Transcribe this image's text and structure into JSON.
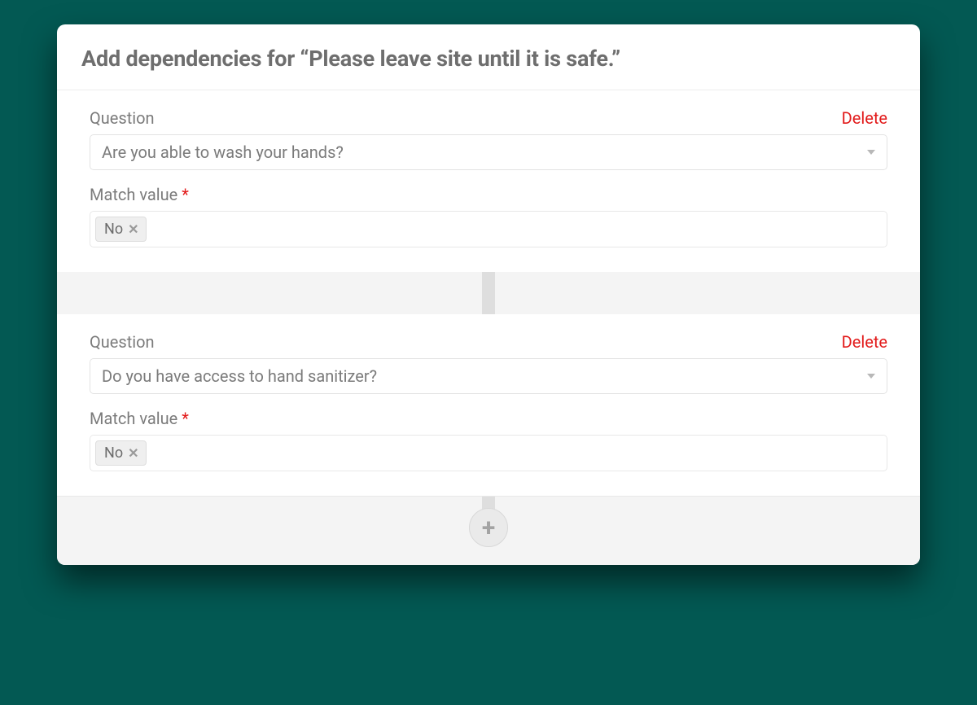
{
  "header": {
    "title": "Add dependencies for “Please leave site until it is safe.”"
  },
  "labels": {
    "question": "Question",
    "match_value": "Match value",
    "delete": "Delete"
  },
  "dependencies": [
    {
      "question": "Are you able to wash your hands?",
      "match_value": "No"
    },
    {
      "question": "Do you have access to hand sanitizer?",
      "match_value": "No"
    }
  ]
}
